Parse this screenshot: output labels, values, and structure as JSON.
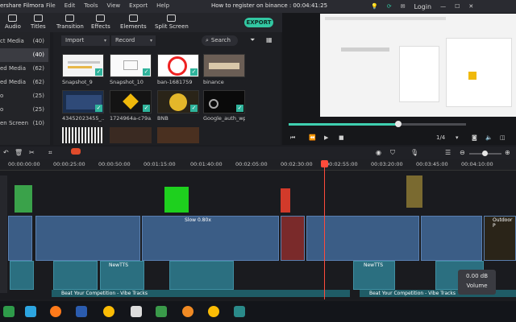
{
  "titlebar": {
    "app_name": "ershare Filmora",
    "menu": [
      "File",
      "Edit",
      "Tools",
      "View",
      "Export",
      "Help"
    ],
    "document": "How to register on binance : 00:04:41:25",
    "login": "Login"
  },
  "toolbar": {
    "tabs": [
      "Audio",
      "Titles",
      "Transition",
      "Effects",
      "Elements",
      "Split Screen"
    ],
    "export_label": "EXPORT"
  },
  "sidebar": {
    "items": [
      {
        "label": "ct Media",
        "count": "(40)"
      },
      {
        "label": "",
        "count": "(40)"
      },
      {
        "label": "ed Media",
        "count": "(62)"
      },
      {
        "label": "ed Media",
        "count": "(62)"
      },
      {
        "label": "o",
        "count": "(25)"
      },
      {
        "label": "o",
        "count": "(25)"
      },
      {
        "label": "en Screen",
        "count": "(10)"
      }
    ]
  },
  "library": {
    "import_label": "Import",
    "record_label": "Record",
    "search_placeholder": "Search",
    "items": [
      {
        "caption": "Snapshot_9"
      },
      {
        "caption": "Snapshot_10"
      },
      {
        "caption": "ban-1681759"
      },
      {
        "caption": "binance"
      },
      {
        "caption": "43452023455_..."
      },
      {
        "caption": "1724964a-c79a..."
      },
      {
        "caption": "BNB"
      },
      {
        "caption": "Google_auth_wp"
      }
    ]
  },
  "preview": {
    "progress": 0.62,
    "page_fraction": "1/4"
  },
  "timeline": {
    "ruler": [
      "00:00:00:00",
      "00:00:25:00",
      "00:00:50:00",
      "00:01:15:00",
      "00:01:40:00",
      "00:02:05:00",
      "00:02:30:00",
      "00:02:55:00",
      "00:03:20:00",
      "00:03:45:00",
      "00:04:10:00"
    ],
    "clip_texts": {
      "slow_clip": "Slow 0.80x",
      "outdoor": "Outdoor P",
      "music_a": "Beat Your Competition - Vibe Tracks",
      "music_b": "Beat Your Competition - Vibe Tracks",
      "audio_label": "NewTTS"
    }
  },
  "tooltip": {
    "db": "0.00 dB",
    "label": "Volume"
  },
  "colors": {
    "accent": "#32c7a2",
    "playhead": "#ff4b3b"
  }
}
